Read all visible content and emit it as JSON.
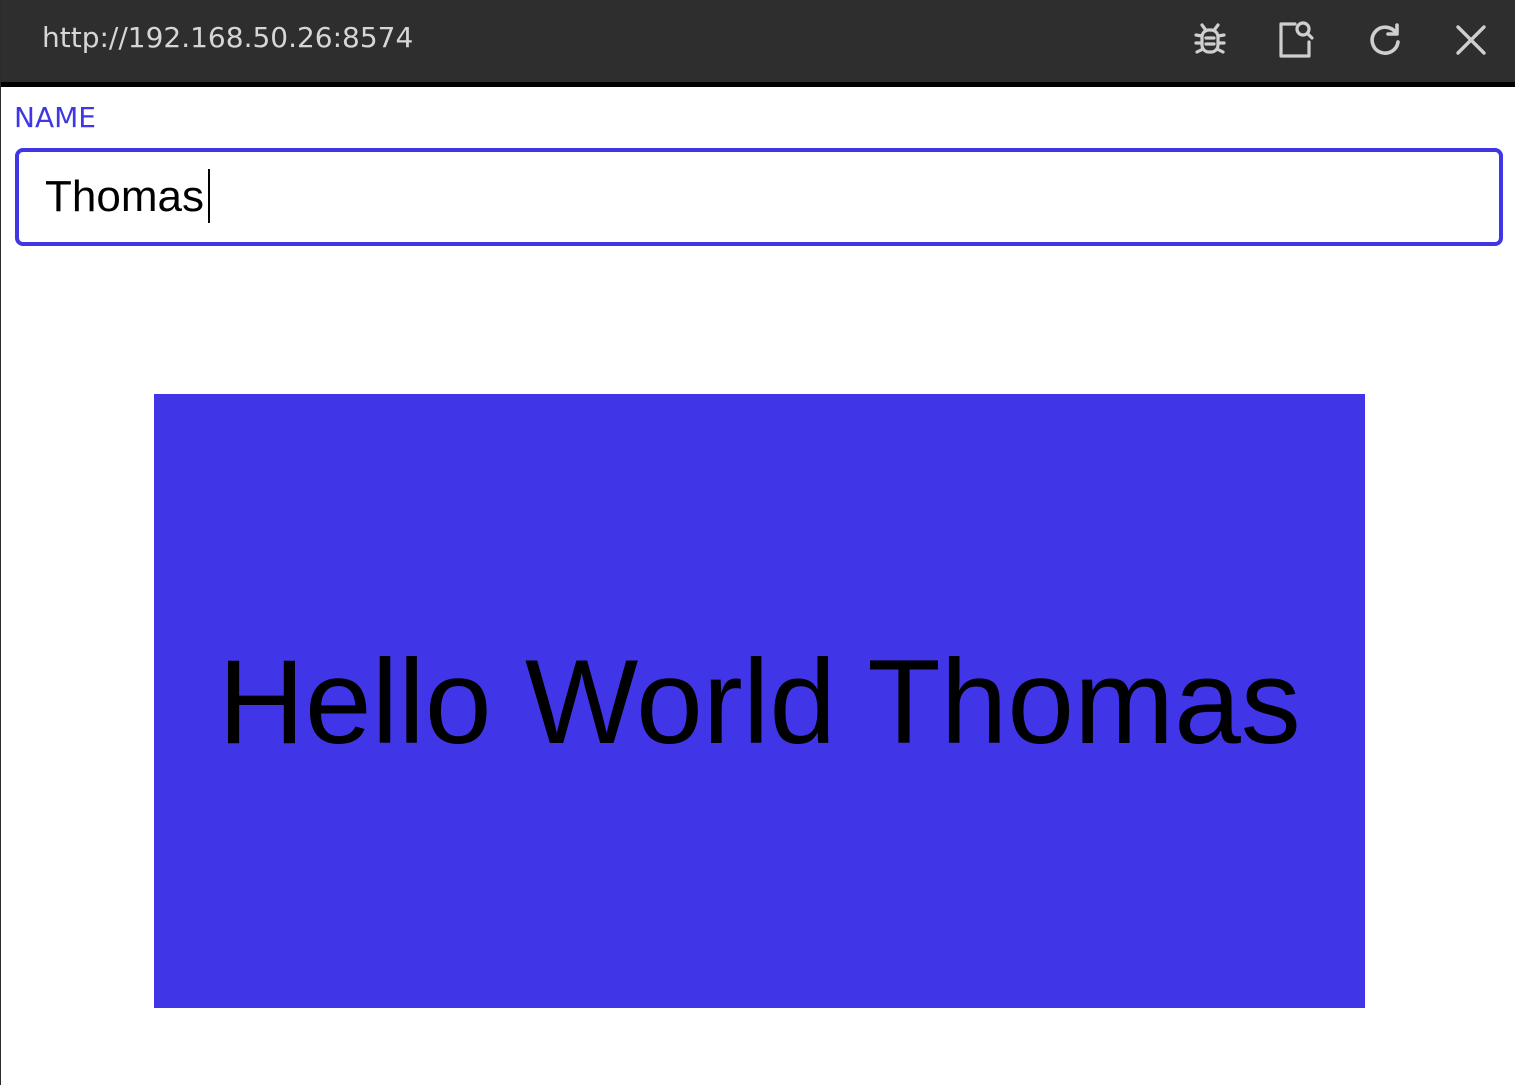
{
  "titlebar": {
    "url": "http://192.168.50.26:8574",
    "buttons": [
      {
        "icon": "bug-icon"
      },
      {
        "icon": "inspect-icon"
      },
      {
        "icon": "reload-icon"
      },
      {
        "icon": "close-icon"
      }
    ]
  },
  "form": {
    "name_label": "NAME",
    "name_value": "Thomas"
  },
  "greeting": {
    "text": "Hello World Thomas"
  },
  "colors": {
    "accent": "#4036e6",
    "titlebar_bg": "#2e2e2e",
    "greeting_bg": "#4036e8"
  }
}
